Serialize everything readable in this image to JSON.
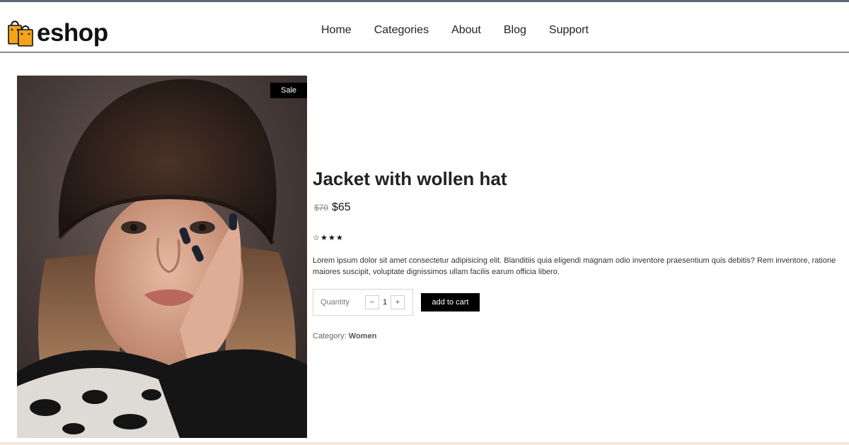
{
  "brand": {
    "name": "eshop",
    "accent": "#f2a51a"
  },
  "nav": {
    "items": [
      "Home",
      "Categories",
      "About",
      "Blog",
      "Support"
    ]
  },
  "product": {
    "sale_badge": "Sale",
    "title": "Jacket with wollen hat",
    "price_old": "$70",
    "price_new": "$65",
    "rating": {
      "filled": 3,
      "total": 4,
      "filled_char": "★",
      "empty_char": "☆"
    },
    "description": "Lorem ipsum dolor sit amet consectetur adipisicing elit. Blanditiis quia eligendi magnam odio inventore praesentium quis debitis? Rem inventore, ratione maiores suscipit, voluptate dignissimos ullam facilis earum officia libero.",
    "quantity": {
      "label": "Quantity",
      "value": "1",
      "minus": "−",
      "plus": "+"
    },
    "add_to_cart": "add to cart",
    "category": {
      "label": "Category:",
      "value": "Women"
    }
  }
}
